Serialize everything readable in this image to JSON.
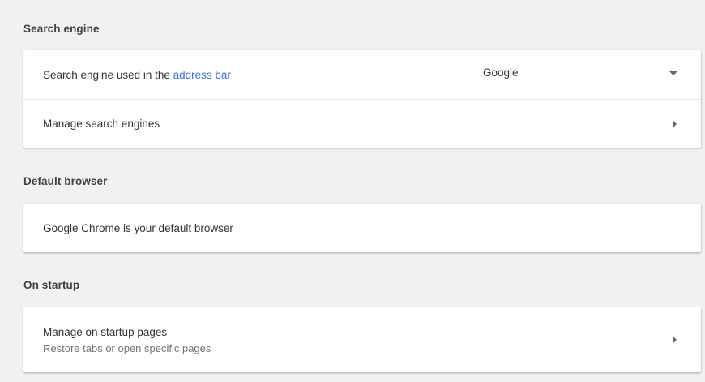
{
  "sections": {
    "search_engine": {
      "title": "Search engine",
      "engine_row": {
        "label_prefix": "Search engine used in the ",
        "label_link": "address bar",
        "selected": "Google"
      },
      "manage_row": {
        "label": "Manage search engines"
      }
    },
    "default_browser": {
      "title": "Default browser",
      "status_row": {
        "label": "Google Chrome is your default browser"
      }
    },
    "on_startup": {
      "title": "On startup",
      "manage_row": {
        "label": "Manage on startup pages",
        "sublabel": "Restore tabs or open specific pages"
      }
    }
  },
  "icons": {
    "dropdown": "chevron-down-icon",
    "submenu": "chevron-right-icon"
  },
  "colors": {
    "background": "#f1f1f1",
    "card": "#ffffff",
    "link": "#3b6fd4",
    "secondary_text": "#757575"
  }
}
